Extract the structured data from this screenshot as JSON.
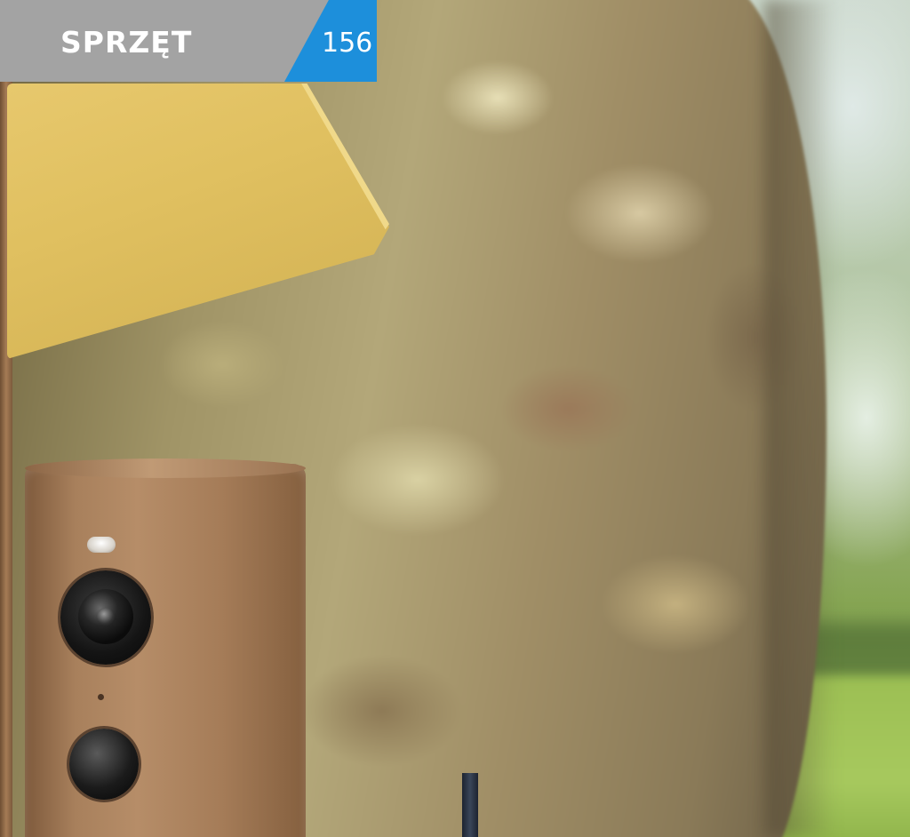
{
  "header": {
    "section_label": "SPRZĘT",
    "page_number": "156"
  },
  "colors": {
    "header_gray": "#a3a3a3",
    "header_blue": "#1d8fdb",
    "roof_yellow": "#e0c060",
    "camera_brown": "#a8805c"
  },
  "photo": {
    "subject_icons": [
      "security-camera",
      "tree-trunk",
      "yellow-roof",
      "garden-background"
    ]
  }
}
